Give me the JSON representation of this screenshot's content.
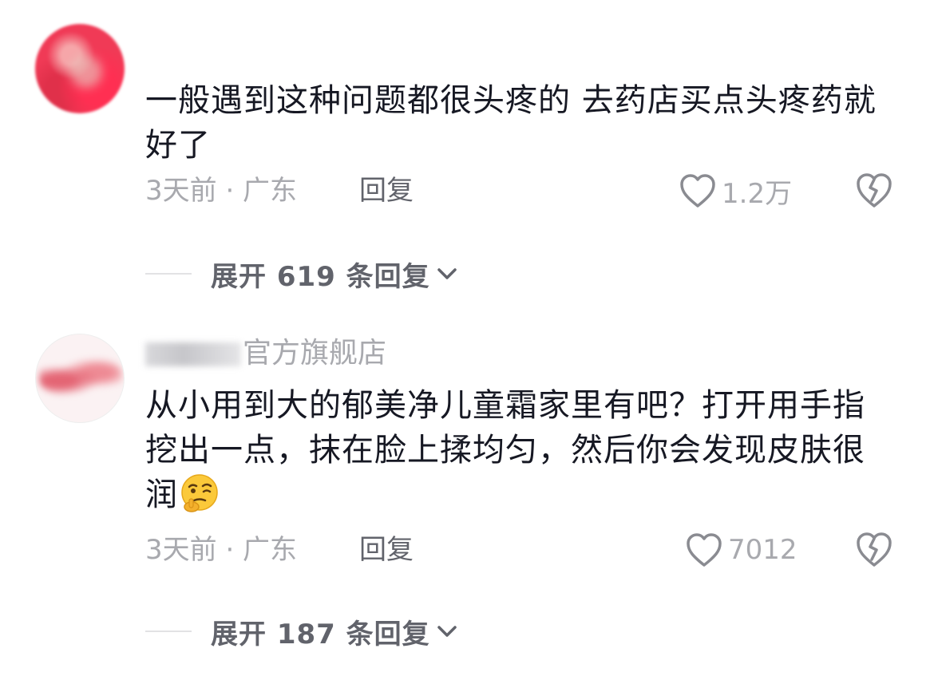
{
  "comments": [
    {
      "text": "一般遇到这种问题都很头疼的 去药店买点头疼药就好了",
      "time_location": "3天前 · 广东",
      "reply_label": "回复",
      "likes": "1.2万",
      "expand_label": "展开 619 条回复"
    },
    {
      "username_suffix": "官方旗舰店",
      "text": "从小用到大的郁美净儿童霜家里有吧？打开用手指挖出一点，抹在脸上揉均匀，然后你会发现皮肤很润",
      "emoji": "thinking-wink-emoji",
      "time_location": "3天前 · 广东",
      "reply_label": "回复",
      "likes": "7012",
      "expand_label": "展开 187 条回复"
    }
  ],
  "colors": {
    "text_primary": "#161823",
    "text_secondary": "#a8a9ae",
    "text_action": "#61636b",
    "divider": "#e2e2e4"
  },
  "icons": {
    "like": "heart-outline-icon",
    "dislike": "broken-heart-icon",
    "expand": "chevron-down-icon"
  }
}
